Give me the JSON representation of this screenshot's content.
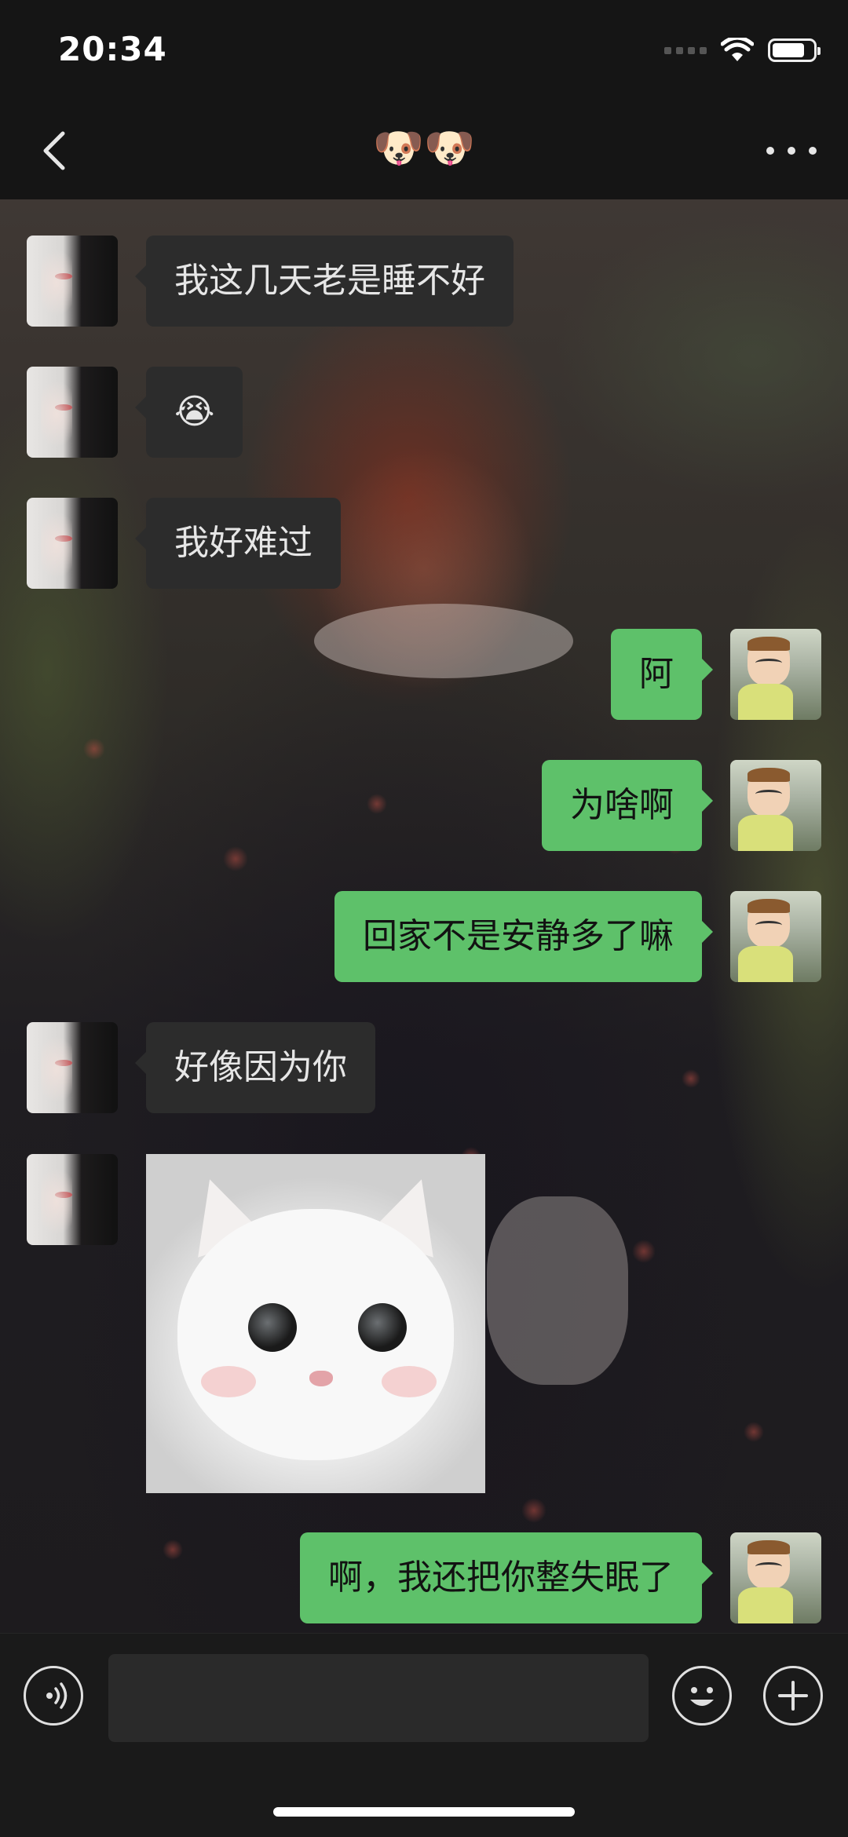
{
  "status_bar": {
    "time": "20:34"
  },
  "nav": {
    "title": "🐶🐶"
  },
  "messages": [
    {
      "side": "left",
      "type": "text",
      "text": "我这几天老是睡不好"
    },
    {
      "side": "left",
      "type": "text",
      "text": "😭"
    },
    {
      "side": "left",
      "type": "text",
      "text": "我好难过"
    },
    {
      "side": "right",
      "type": "text",
      "text": "阿"
    },
    {
      "side": "right",
      "type": "text",
      "text": "为啥啊"
    },
    {
      "side": "right",
      "type": "text",
      "text": "回家不是安静多了嘛"
    },
    {
      "side": "left",
      "type": "text",
      "text": "好像因为你"
    },
    {
      "side": "left",
      "type": "sticker",
      "icon": "white-kitten-sticker"
    },
    {
      "side": "right",
      "type": "text",
      "text": "啊，我还把你整失眠了"
    }
  ],
  "input": {
    "value": ""
  },
  "colors": {
    "outgoing_bubble": "#5ec16a",
    "incoming_bubble": "#2c2c2c",
    "bar_background": "#151515"
  }
}
